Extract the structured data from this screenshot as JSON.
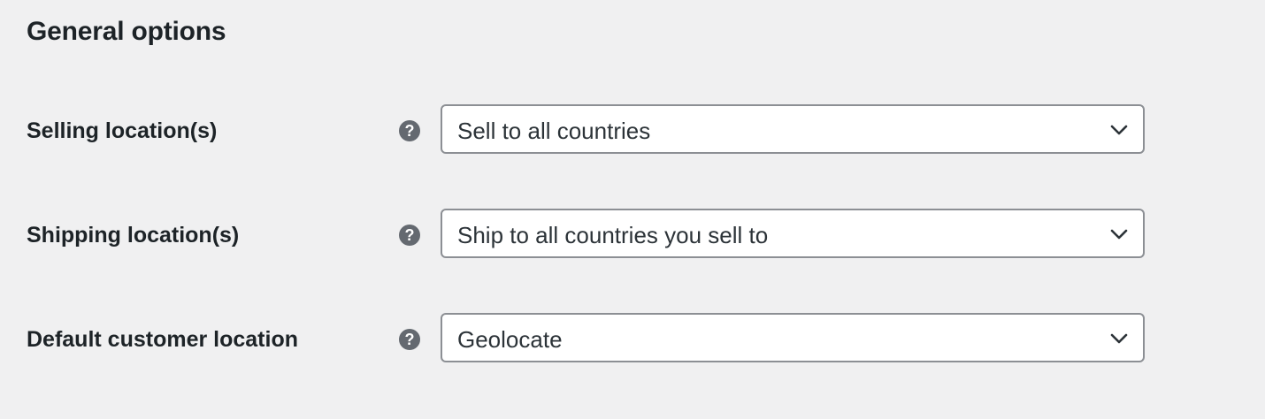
{
  "section": {
    "title": "General options"
  },
  "fields": [
    {
      "label": "Selling location(s)",
      "help_icon": "question-mark",
      "value": "Sell to all countries"
    },
    {
      "label": "Shipping location(s)",
      "help_icon": "question-mark",
      "value": "Ship to all countries you sell to"
    },
    {
      "label": "Default customer location",
      "help_icon": "question-mark",
      "value": "Geolocate"
    }
  ],
  "colors": {
    "background": "#f0f0f1",
    "text": "#1d2327",
    "help_icon": "#646970",
    "select_border": "#8c8f94"
  },
  "help_glyph": "?"
}
